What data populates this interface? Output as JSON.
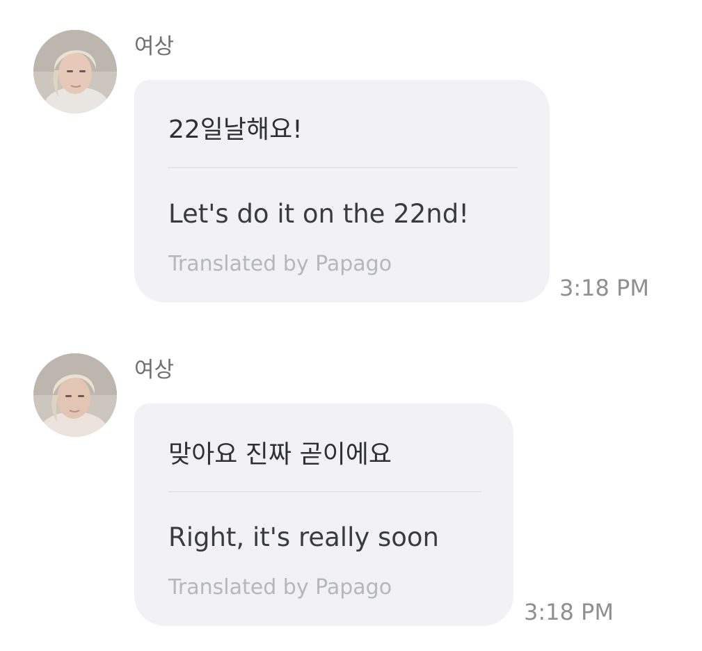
{
  "messages": [
    {
      "sender": "여상",
      "original": "22일날해요!",
      "translation": "Let's do it on the 22nd!",
      "credit": "Translated by Papago",
      "time": "3:18 PM"
    },
    {
      "sender": "여상",
      "original": "맞아요 진짜 곧이에요",
      "translation": "Right, it's really soon",
      "credit": "Translated by Papago",
      "time": "3:18 PM"
    }
  ],
  "colors": {
    "bubble": "#f2f2f5",
    "sender": "#6e6e73",
    "text": "#2f3033",
    "credit": "#b5b7bd",
    "time": "#8e8e93"
  }
}
